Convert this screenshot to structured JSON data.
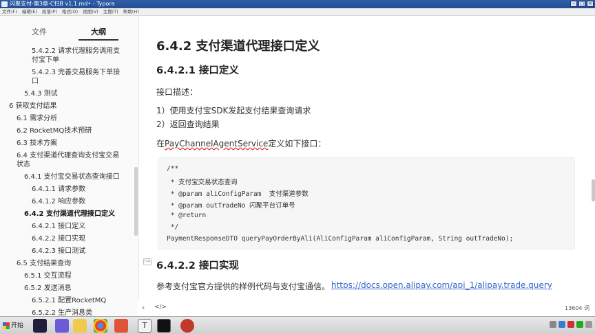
{
  "window": {
    "title": "闪聚支付-第3章-C扫B v1.1.md• - Typora"
  },
  "menu": [
    "文件(F)",
    "编辑(E)",
    "段落(P)",
    "格式(O)",
    "视图(V)",
    "主题(T)",
    "帮助(H)"
  ],
  "sidebar": {
    "tab_files": "文件",
    "tab_outline": "大纲",
    "items": [
      {
        "text": "5.4.2.2 请求代理服务调用支",
        "level": 3
      },
      {
        "text": "付宝下单",
        "level": 3
      },
      {
        "text": "5.4.2.3 完善交易服务下单接",
        "level": 3
      },
      {
        "text": "口",
        "level": 3
      },
      {
        "text": "5.4.3 测试",
        "level": 2
      },
      {
        "text": "6 获取支付结果",
        "level": 0
      },
      {
        "text": "6.1 需求分析",
        "level": 1
      },
      {
        "text": "6.2 RocketMQ技术预研",
        "level": 1
      },
      {
        "text": "6.3 技术方案",
        "level": 1
      },
      {
        "text": "6.4 支付渠道代理查询支付宝交易",
        "level": 1
      },
      {
        "text": "状态",
        "level": 1
      },
      {
        "text": "6.4.1 支付宝交易状态查询接口",
        "level": 2
      },
      {
        "text": "6.4.1.1 请求参数",
        "level": 3
      },
      {
        "text": "6.4.1.2 响应参数",
        "level": 3
      },
      {
        "text": "6.4.2 支付渠道代理接口定义",
        "level": 2
      },
      {
        "text": "6.4.2.1 接口定义",
        "level": 3
      },
      {
        "text": "6.4.2.2 接口实现",
        "level": 3
      },
      {
        "text": "6.4.2.3 接口测试",
        "level": 3
      },
      {
        "text": "6.5 支付结果查询",
        "level": 1
      },
      {
        "text": "6.5.1 交互流程",
        "level": 2
      },
      {
        "text": "6.5.2 发送消息",
        "level": 2
      },
      {
        "text": "6.5.2.1 配置RocketMQ",
        "level": 3
      },
      {
        "text": "6.5.2.2 生产消息类",
        "level": 3
      }
    ]
  },
  "doc": {
    "h2": "6.4.2 支付渠道代理接口定义",
    "h3_1": "6.4.2.1 接口定义",
    "desc_label": "接口描述：",
    "list_1": "1）使用支付宝SDK发起支付结果查询请求",
    "list_2": "2）返回查询结果",
    "define_prefix": "在",
    "define_class": "PayChannelAgentService",
    "define_suffix": "定义如下接口：",
    "code_lines": [
      "/**",
      " * 支付宝交易状态查询",
      " * @param aliConfigParam  支付渠道参数",
      " * @param outTradeNo 闪聚平台订单号",
      " * @return",
      " */",
      "PaymentResponseDTO queryPayOrderByAli(AliConfigParam aliConfigParam, String outTradeNo);"
    ],
    "h3_2": "6.4.2.2 接口实现",
    "ref_text": "参考支付宝官方提供的样例代码与支付宝通信。",
    "ref_link": "https://docs.open.alipay.com/api_1/alipay.trade.query"
  },
  "status": {
    "word_count": "13604 词"
  },
  "taskbar": {
    "start_label": "开始"
  }
}
